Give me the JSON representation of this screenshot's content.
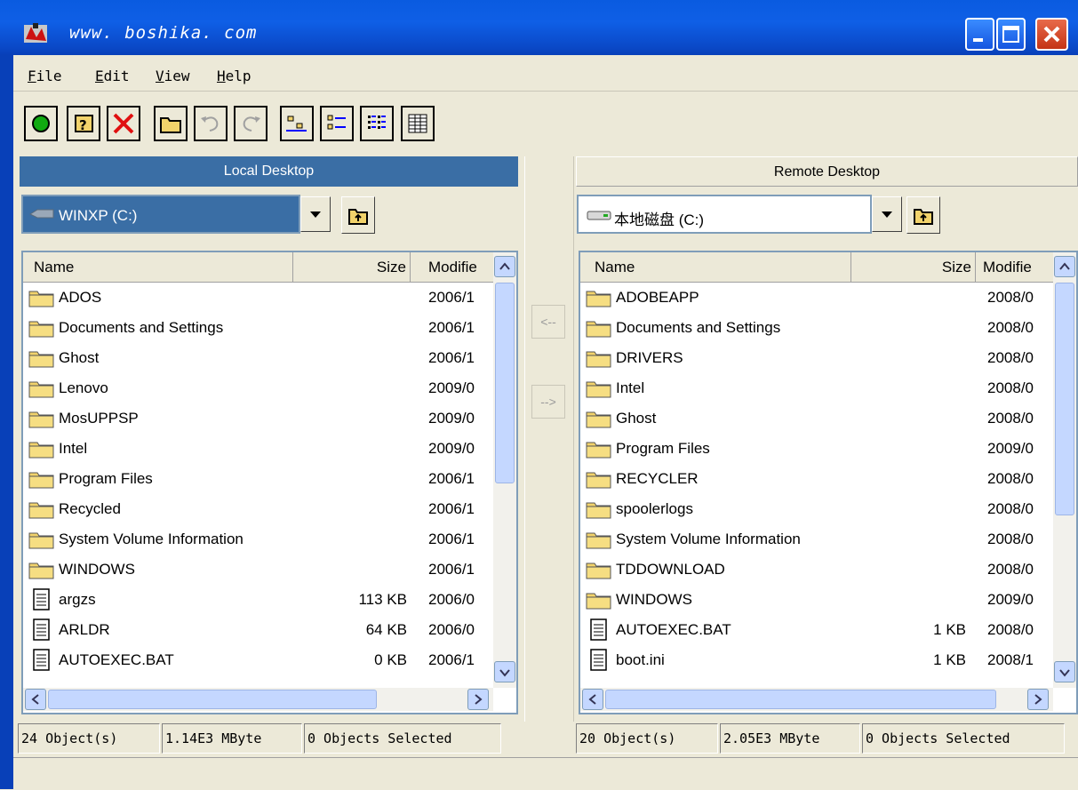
{
  "window": {
    "title": "www. boshika. com"
  },
  "menu": [
    {
      "key": "F",
      "rest": "ile"
    },
    {
      "key": "E",
      "rest": "dit"
    },
    {
      "key": "V",
      "rest": "iew"
    },
    {
      "key": "H",
      "rest": "elp"
    }
  ],
  "toolbar": [
    "connect",
    "properties",
    "delete",
    "new-folder",
    "undo",
    "redo",
    "large-icons",
    "small-icons",
    "list",
    "details"
  ],
  "local": {
    "header": "Local Desktop",
    "drive": "WINXP (C:)",
    "columns": {
      "name": "Name",
      "size": "Size",
      "modified": "Modifie"
    },
    "rows": [
      {
        "type": "folder",
        "name": "ADOS",
        "size": "",
        "modified": "2006/1"
      },
      {
        "type": "folder",
        "name": "Documents and Settings",
        "size": "",
        "modified": "2006/1"
      },
      {
        "type": "folder",
        "name": "Ghost",
        "size": "",
        "modified": "2006/1"
      },
      {
        "type": "folder",
        "name": "Lenovo",
        "size": "",
        "modified": "2009/0"
      },
      {
        "type": "folder",
        "name": "MosUPPSP",
        "size": "",
        "modified": "2009/0"
      },
      {
        "type": "folder",
        "name": "Intel",
        "size": "",
        "modified": "2009/0"
      },
      {
        "type": "folder",
        "name": "Program Files",
        "size": "",
        "modified": "2006/1"
      },
      {
        "type": "folder",
        "name": "Recycled",
        "size": "",
        "modified": "2006/1"
      },
      {
        "type": "folder",
        "name": "System Volume Information",
        "size": "",
        "modified": "2006/1"
      },
      {
        "type": "folder",
        "name": "WINDOWS",
        "size": "",
        "modified": "2006/1"
      },
      {
        "type": "file",
        "name": "argzs",
        "size": "113 KB",
        "modified": "2006/0"
      },
      {
        "type": "file",
        "name": "ARLDR",
        "size": "64 KB",
        "modified": "2006/0"
      },
      {
        "type": "file",
        "name": "AUTOEXEC.BAT",
        "size": "0 KB",
        "modified": "2006/1"
      }
    ],
    "status": [
      "24 Object(s)",
      "1.14E3 MByte",
      "0 Objects Selected"
    ]
  },
  "remote": {
    "header": "Remote Desktop",
    "drive": "本地磁盘 (C:)",
    "columns": {
      "name": "Name",
      "size": "Size",
      "modified": "Modifie"
    },
    "rows": [
      {
        "type": "folder",
        "name": "ADOBEAPP",
        "size": "",
        "modified": "2008/0"
      },
      {
        "type": "folder",
        "name": "Documents and Settings",
        "size": "",
        "modified": "2008/0"
      },
      {
        "type": "folder",
        "name": "DRIVERS",
        "size": "",
        "modified": "2008/0"
      },
      {
        "type": "folder",
        "name": "Intel",
        "size": "",
        "modified": "2008/0"
      },
      {
        "type": "folder",
        "name": "Ghost",
        "size": "",
        "modified": "2008/0"
      },
      {
        "type": "folder",
        "name": "Program Files",
        "size": "",
        "modified": "2009/0"
      },
      {
        "type": "folder",
        "name": "RECYCLER",
        "size": "",
        "modified": "2008/0"
      },
      {
        "type": "folder",
        "name": "spoolerlogs",
        "size": "",
        "modified": "2008/0"
      },
      {
        "type": "folder",
        "name": "System Volume Information",
        "size": "",
        "modified": "2008/0"
      },
      {
        "type": "folder",
        "name": "TDDOWNLOAD",
        "size": "",
        "modified": "2008/0"
      },
      {
        "type": "folder",
        "name": "WINDOWS",
        "size": "",
        "modified": "2009/0"
      },
      {
        "type": "file",
        "name": "AUTOEXEC.BAT",
        "size": "1 KB",
        "modified": "2008/0"
      },
      {
        "type": "file",
        "name": "boot.ini",
        "size": "1 KB",
        "modified": "2008/1"
      }
    ],
    "status": [
      "20 Object(s)",
      "2.05E3 MByte",
      "0 Objects Selected"
    ]
  },
  "transfer": {
    "to_local": "<--",
    "to_remote": "-->"
  },
  "colors": {
    "titlebar": "#0a5be0",
    "selection": "#3a6ea5",
    "face": "#ece9d8",
    "folder": "#f2d36b"
  }
}
